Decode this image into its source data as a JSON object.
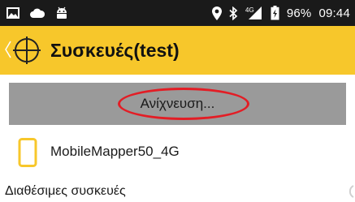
{
  "status_bar": {
    "battery_percent": "96%",
    "time": "09:44",
    "network_type": "4G",
    "icons": [
      "gallery-icon",
      "cloud-icon",
      "android-icon",
      "location-icon",
      "bluetooth-icon",
      "signal-icon",
      "battery-icon"
    ]
  },
  "app_bar": {
    "title": "Συσκευές(test)",
    "icons": [
      "chevron-left-icon",
      "crosshair-logo-icon"
    ]
  },
  "scan_button": {
    "label": "Ανίχνευση..."
  },
  "devices": [
    {
      "name": "MobileMapper50_4G",
      "icon": "phone-icon"
    }
  ],
  "available_devices_header": "Διαθέσιμες συσκευές",
  "colors": {
    "status_bar_bg": "#1a1a1a",
    "app_bar_bg": "#f7c72b",
    "scan_button_bg": "#9a9a9a",
    "highlight_ellipse": "#e31d25",
    "device_icon": "#f7c72b"
  }
}
